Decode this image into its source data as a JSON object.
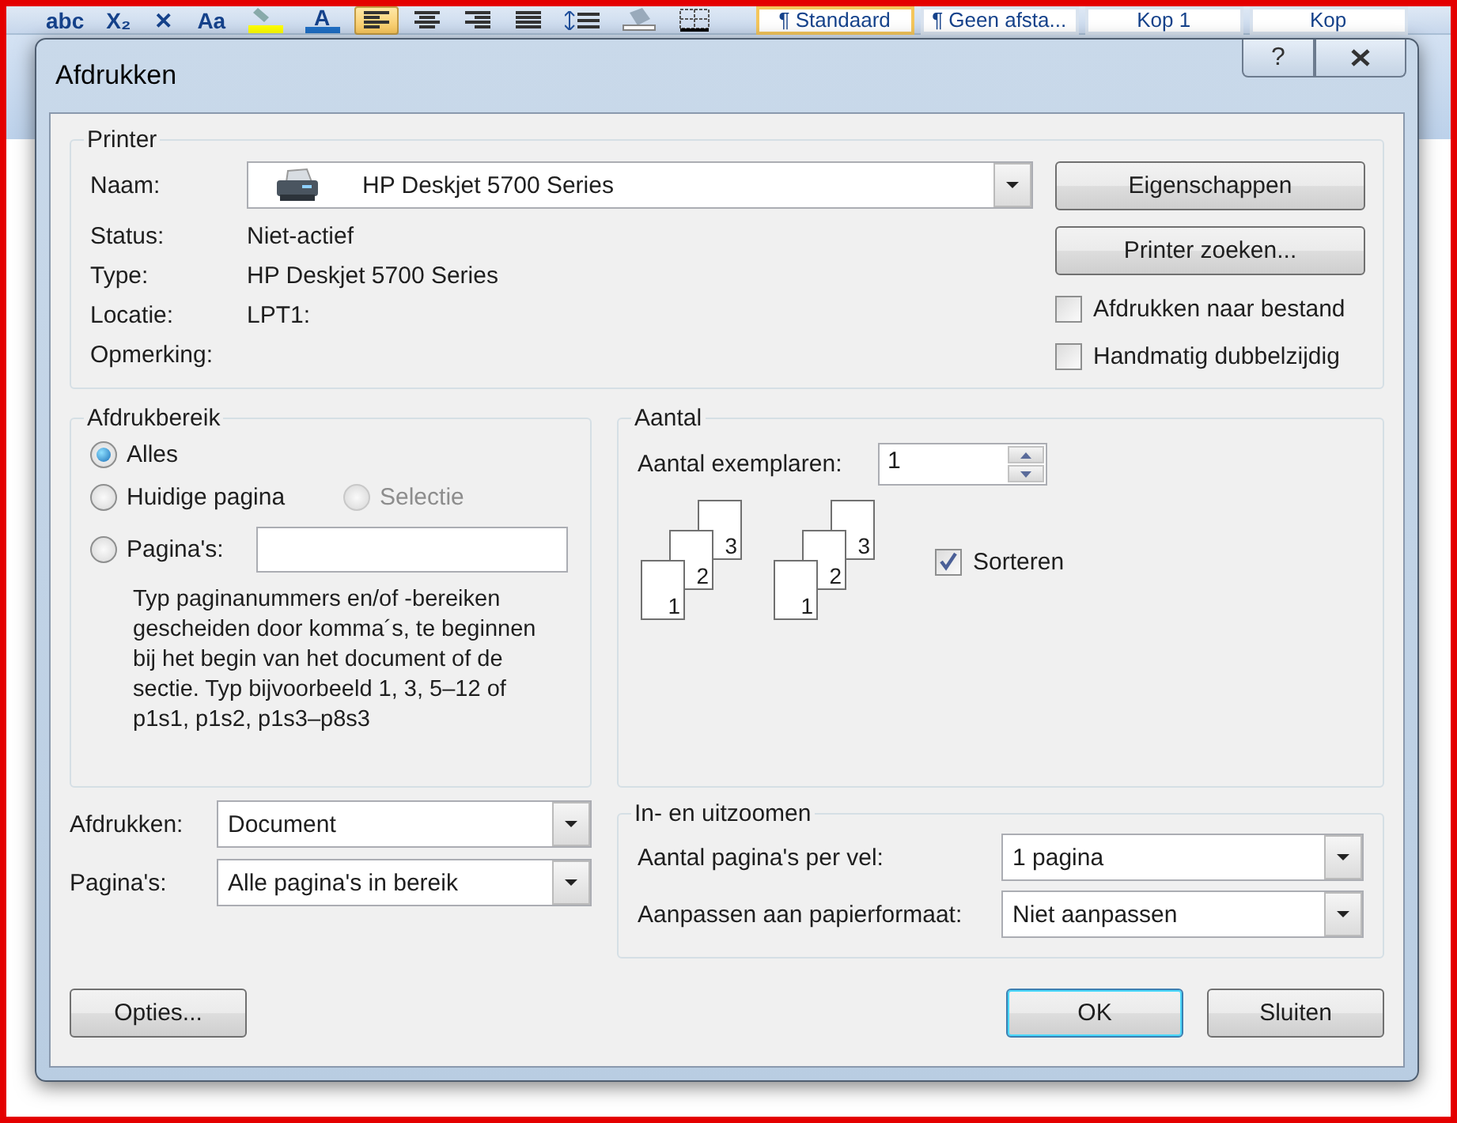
{
  "toolbar": {
    "buttons": [
      {
        "kind": "text",
        "label": "abc",
        "selected": false
      },
      {
        "kind": "text",
        "label": "X₂",
        "selected": false
      },
      {
        "kind": "text",
        "label": "✕",
        "selected": false
      },
      {
        "kind": "text",
        "label": "Aa",
        "selected": false
      },
      {
        "kind": "highlight",
        "selected": false
      },
      {
        "kind": "fontcolor",
        "label": "A",
        "selected": false
      },
      {
        "kind": "align-left",
        "selected": true
      },
      {
        "kind": "align-center",
        "selected": false
      },
      {
        "kind": "align-right",
        "selected": false
      },
      {
        "kind": "justify",
        "selected": false
      },
      {
        "kind": "spacing",
        "selected": false
      },
      {
        "kind": "shading",
        "selected": false
      },
      {
        "kind": "borders",
        "selected": false
      }
    ],
    "styles": [
      {
        "label": "¶ Standaard",
        "selected": true
      },
      {
        "label": "¶ Geen afsta...",
        "selected": false
      },
      {
        "label": "Kop 1",
        "selected": false
      },
      {
        "label": "Kop",
        "selected": false
      }
    ]
  },
  "dialog": {
    "title": "Afdrukken",
    "help": "?",
    "printer": {
      "heading": "Printer",
      "name_label": "Naam:",
      "name_value": "HP Deskjet 5700 Series",
      "details": [
        {
          "label": "Status:",
          "value": "Niet-actief"
        },
        {
          "label": "Type:",
          "value": "HP Deskjet 5700 Series"
        },
        {
          "label": "Locatie:",
          "value": "LPT1:"
        },
        {
          "label": "Opmerking:"
        }
      ],
      "buttons": [
        "Eigenschappen",
        "Printer zoeken..."
      ],
      "options": [
        {
          "label": "Afdrukken naar bestand",
          "checked": false
        },
        {
          "label": "Handmatig dubbelzijdig",
          "checked": false
        }
      ]
    },
    "range": {
      "heading": "Afdrukbereik",
      "options": [
        {
          "label": "Alles",
          "selected": true,
          "disabled": false
        },
        {
          "label": "Huidige pagina",
          "selected": false,
          "disabled": false
        },
        {
          "label": "Selectie",
          "selected": false,
          "disabled": true
        },
        {
          "label": "Pagina's:",
          "selected": false,
          "disabled": false
        }
      ],
      "hint": "Typ paginanummers en/of -bereiken gescheiden door komma´s, te beginnen bij het begin van het document of de sectie. Typ bijvoorbeeld 1, 3, 5–12 of p1s1, p1s2, p1s3–p8s3"
    },
    "copies": {
      "heading": "Aantal",
      "label": "Aantal exemplaren:",
      "value": "1",
      "stacks": [
        {
          "pages": [
            "3",
            "2",
            "1"
          ]
        },
        {
          "pages": [
            "3",
            "2",
            "1"
          ]
        }
      ],
      "collate": {
        "label": "Sorteren",
        "checked": true
      }
    },
    "print_what": [
      {
        "label": "Afdrukken:",
        "value": "Document"
      },
      {
        "label": "Pagina's:",
        "value": "Alle pagina's in bereik"
      }
    ],
    "zoom": {
      "heading": "In- en uitzoomen",
      "rows": [
        {
          "label": "Aantal pagina's per vel:",
          "value": "1 pagina"
        },
        {
          "label": "Aanpassen aan papierformaat:",
          "value": "Niet aanpassen"
        }
      ]
    },
    "footer": [
      {
        "label": "Opties...",
        "default": false
      },
      {
        "label": "OK",
        "default": true
      },
      {
        "label": "Sluiten",
        "default": false
      }
    ]
  }
}
